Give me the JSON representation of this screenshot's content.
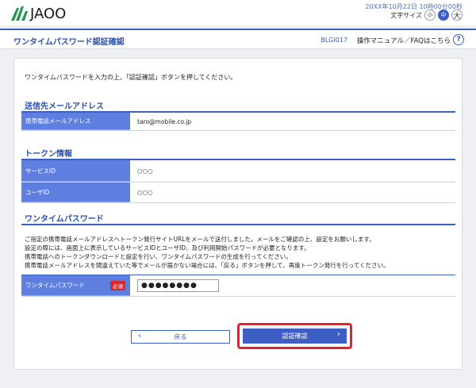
{
  "header": {
    "logo_text": "JAOO",
    "datetime": "20XX年10月22日 10時00分00秒",
    "font_size_label": "文字サイズ",
    "font_sizes": [
      "小",
      "中",
      "大"
    ]
  },
  "titlebar": {
    "title": "ワンタイムパスワード認証確認",
    "screen_id": "BLGI017",
    "manual_link": "操作マニュアル／FAQはこちら",
    "help_icon": "?"
  },
  "intro": "ワンタイムパスワードを入力の上、「認証確認」ボタンを押してください。",
  "sections": {
    "email": {
      "heading": "送信先メールアドレス",
      "label": "携帯電話メールアドレス",
      "value": "taro@mobile.co.jp"
    },
    "token": {
      "heading": "トークン情報",
      "service_label": "サービスID",
      "service_value": "○○○",
      "user_label": "ユーザID",
      "user_value": "○○○"
    },
    "otp": {
      "heading": "ワンタイムパスワード",
      "desc": [
        "ご指定の携帯電話メールアドレスへトークン発行サイトURLをメールで送付しました。メールをご確認の上、設定をお願いします。",
        "設定の際には、画面上に表示しているサービスIDとユーザID、及び利用開始パスワードが必要となります。",
        "携帯電話へのトークンダウンロードと設定を行い、ワンタイムパスワードの生成を行ってください。",
        "携帯電話メールアドレスを間違えていた等でメールが届かない場合には、「戻る」ボタンを押して、再度トークン発行を行ってください。"
      ],
      "label": "ワンタイムパスワード",
      "required": "必須",
      "value": "●●●●●●●●"
    }
  },
  "buttons": {
    "back": "戻る",
    "confirm": "認証確認"
  },
  "colors": {
    "accent": "#3c5ec5",
    "label_bg": "#5e7fe0",
    "highlight": "#e8202a"
  }
}
